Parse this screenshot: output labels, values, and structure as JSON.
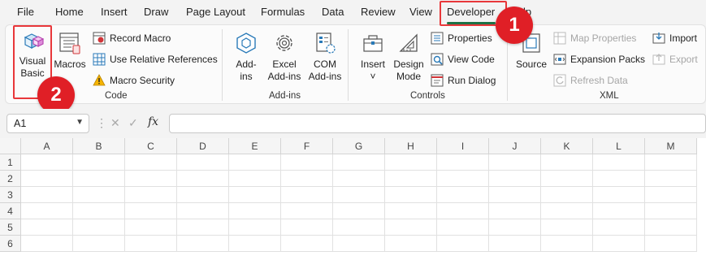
{
  "menu": {
    "tabs": [
      "File",
      "Home",
      "Insert",
      "Draw",
      "Page Layout",
      "Formulas",
      "Data",
      "Review",
      "View",
      "Developer",
      "lp"
    ],
    "active": "Developer"
  },
  "ribbon": {
    "code": {
      "label": "Code",
      "visual_basic_line1": "Visual",
      "visual_basic_line2": "Basic",
      "macros": "Macros",
      "record_macro": "Record Macro",
      "relative_refs": "Use Relative References",
      "macro_security": "Macro Security"
    },
    "addins": {
      "label": "Add-ins",
      "addins_line1": "Add-",
      "addins_line2": "ins",
      "excel_line1": "Excel",
      "excel_line2": "Add-ins",
      "com_line1": "COM",
      "com_line2": "Add-ins"
    },
    "controls": {
      "label": "Controls",
      "insert": "Insert",
      "insert_chevron": "˅",
      "design_line1": "Design",
      "design_line2": "Mode",
      "properties": "Properties",
      "view_code": "View Code",
      "run_dialog": "Run Dialog"
    },
    "xml": {
      "label": "XML",
      "source": "Source",
      "map_properties": "Map Properties",
      "expansion_packs": "Expansion Packs",
      "refresh_data": "Refresh Data",
      "import": "Import",
      "export": "Export"
    }
  },
  "annotations": {
    "badge1": "1",
    "badge2": "2",
    "highlight_color": "#e8373a",
    "badge_color": "#e01f26"
  },
  "formula_bar": {
    "name_box": "A1",
    "fx": "fx",
    "value": ""
  },
  "grid": {
    "columns": [
      "A",
      "B",
      "C",
      "D",
      "E",
      "F",
      "G",
      "H",
      "I",
      "J",
      "K",
      "L",
      "M"
    ],
    "rows": [
      "1",
      "2",
      "3",
      "4",
      "5",
      "6"
    ]
  },
  "colors": {
    "accent": "#1e7145"
  }
}
